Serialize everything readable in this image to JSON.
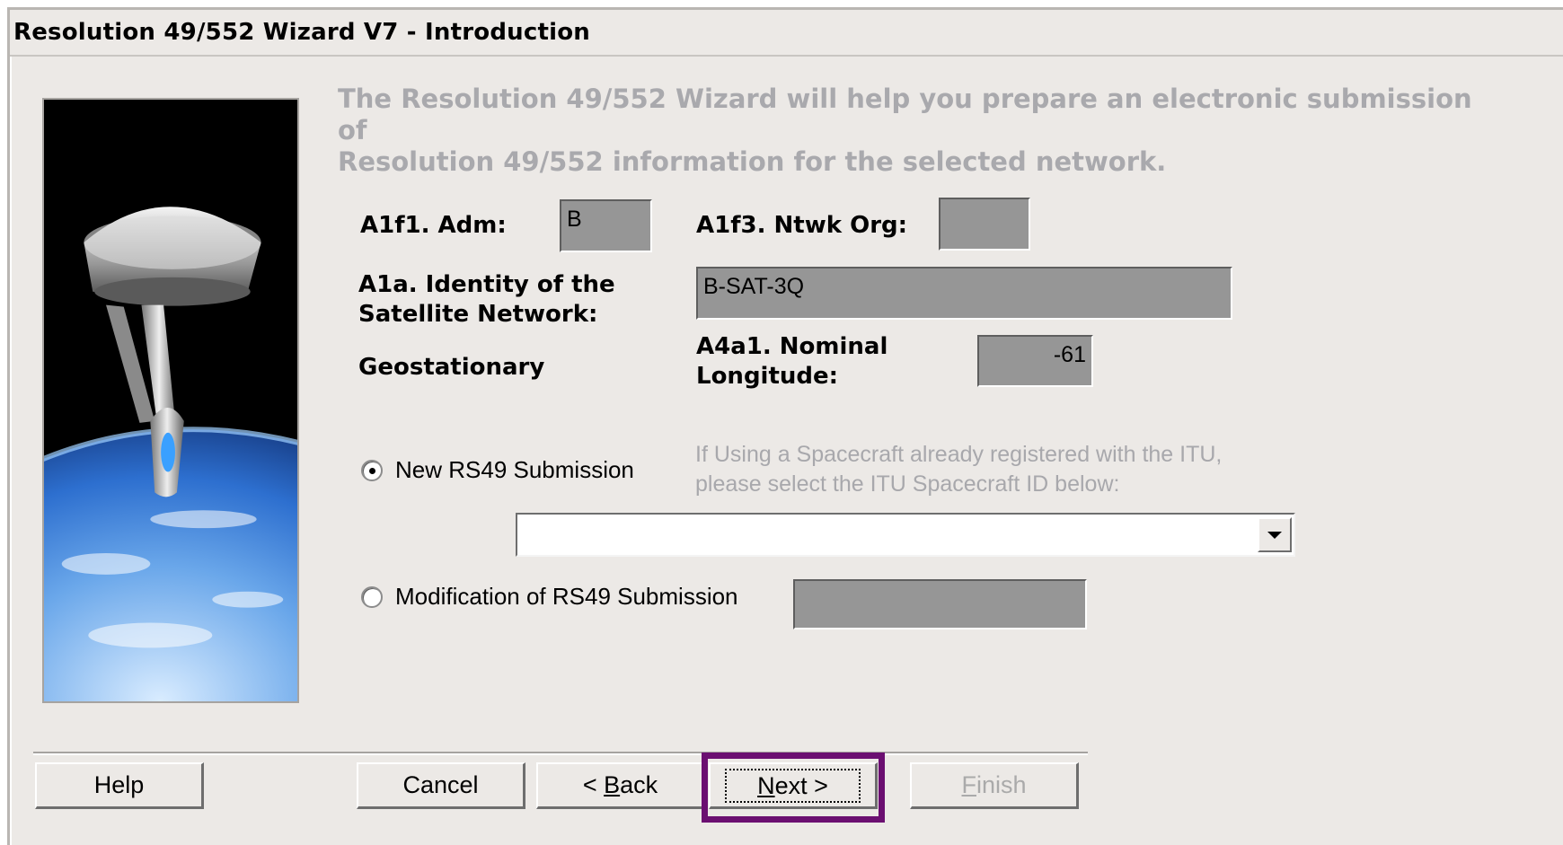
{
  "window": {
    "title": "Resolution 49/552 Wizard V7 - Introduction"
  },
  "intro": {
    "line1": "The Resolution 49/552 Wizard will help you prepare an electronic submission of",
    "line2": "Resolution 49/552 information for the selected network."
  },
  "form": {
    "adm_label": "A1f1.  Adm:",
    "adm_value": "B",
    "org_label": "A1f3. Ntwk Org:",
    "org_value": "",
    "identity_label_1": "A1a.  Identity of the",
    "identity_label_2": "Satellite Network:",
    "identity_value": "B-SAT-3Q",
    "orbit_label": "Geostationary",
    "longitude_label_1": "A4a1. Nominal",
    "longitude_label_2": "Longitude:",
    "longitude_value": "-61"
  },
  "submission": {
    "new_label": "New RS49 Submission",
    "new_selected": true,
    "hint_line1": "If Using a Spacecraft already registered with the ITU,",
    "hint_line2": "please select the ITU Spacecraft ID below:",
    "spacecraft_selected": "",
    "modification_label": "Modification of  RS49 Submission",
    "modification_selected": false,
    "modification_value": ""
  },
  "buttons": {
    "help": "Help",
    "cancel": "Cancel",
    "back_prefix": "< ",
    "back_mnemonic": "B",
    "back_rest": "ack",
    "next_mnemonic": "N",
    "next_rest": "ext >",
    "finish_mnemonic": "F",
    "finish_rest": "inish"
  },
  "colors": {
    "highlight": "#6b0f71",
    "dialog_bg": "#ece9e6",
    "field_bg": "#969696"
  },
  "icons": {
    "side_image": "spacecraft-over-earth-illustration",
    "dropdown": "chevron-down-icon"
  }
}
